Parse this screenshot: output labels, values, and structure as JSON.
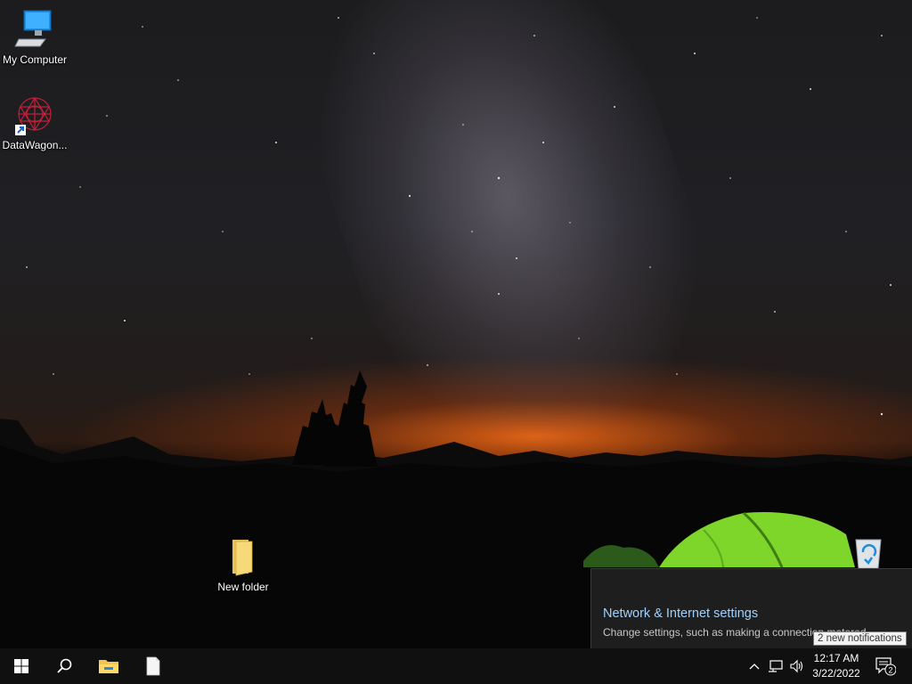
{
  "desktop": {
    "icons": [
      {
        "label": "My Computer",
        "icon": "computer-icon"
      },
      {
        "label": "DataWagon...",
        "icon": "datawagon-shortcut-icon"
      },
      {
        "label": "New folder",
        "icon": "folder-icon"
      },
      {
        "label": "",
        "icon": "recycle-bin-icon"
      }
    ]
  },
  "network_flyout": {
    "title": "Network & Internet settings",
    "subtitle": "Change settings, such as making a connection metered."
  },
  "tooltip": {
    "text": "2 new notifications"
  },
  "taskbar": {
    "buttons": [
      "start-icon",
      "search-icon",
      "file-explorer-icon",
      "document-icon"
    ],
    "tray": [
      "chevron-up-icon",
      "network-icon",
      "volume-icon"
    ],
    "clock": {
      "time": "12:17 AM",
      "date": "3/22/2022"
    },
    "notifications": {
      "icon": "action-center-icon",
      "count": "2"
    }
  },
  "colors": {
    "link": "#9fd2ff",
    "taskbar": "#101010",
    "tent": "#7fd62a",
    "horizon_glow": "#ff6e14"
  }
}
